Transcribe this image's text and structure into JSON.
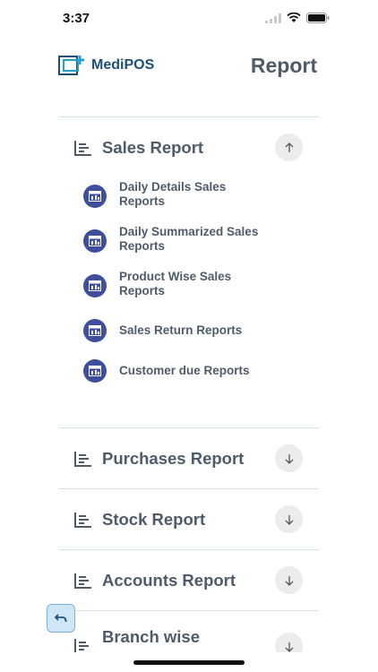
{
  "status": {
    "time": "3:37"
  },
  "header": {
    "app_name": "MediPOS",
    "title": "Report"
  },
  "sections": [
    {
      "title": "Sales Report",
      "expanded": true,
      "items": [
        {
          "label": "Daily Details Sales Reports"
        },
        {
          "label": "Daily Summarized Sales Reports"
        },
        {
          "label": "Product Wise Sales Reports"
        },
        {
          "label": "Sales Return Reports"
        },
        {
          "label": "Customer due Reports"
        }
      ]
    },
    {
      "title": "Purchases Report",
      "expanded": false
    },
    {
      "title": "Stock Report",
      "expanded": false
    },
    {
      "title": "Accounts Report",
      "expanded": false
    },
    {
      "title": "Branch wise",
      "expanded": false
    }
  ],
  "colors": {
    "primary": "#3f4f9e",
    "text": "#4d5b6a",
    "divider": "#cfe0ec"
  }
}
